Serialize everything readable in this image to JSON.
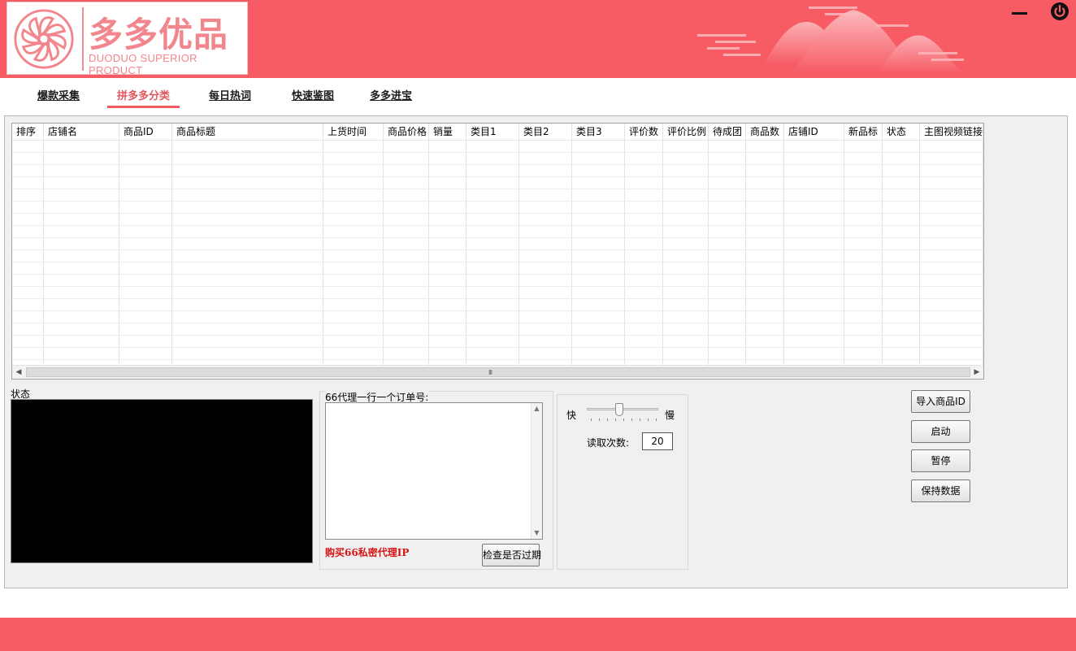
{
  "app": {
    "logo_cn": "多多优品",
    "logo_en": "DUODUO SUPERIOR PRODUCT"
  },
  "tabs": [
    {
      "label": "爆款采集",
      "active": false
    },
    {
      "label": "拼多多分类",
      "active": true
    },
    {
      "label": "每日热词",
      "active": false
    },
    {
      "label": "快速鉴图",
      "active": false
    },
    {
      "label": "多多进宝",
      "active": false
    }
  ],
  "grid": {
    "columns": [
      "排序",
      "店铺名",
      "商品ID",
      "商品标题",
      "上货时间",
      "商品价格",
      "销量",
      "类目1",
      "类目2",
      "类目3",
      "评价数",
      "评价比例",
      "待成团",
      "商品数",
      "店铺ID",
      "新品标",
      "状态",
      "主图视频链接"
    ],
    "rows": [],
    "scroll_grip": "III"
  },
  "status": {
    "label": "状态"
  },
  "proxy": {
    "label": "66代理一行一个订单号:",
    "value": "",
    "buy_link": "购买66私密代理IP",
    "check_button": "检查是否过期"
  },
  "speed": {
    "fast_label": "快",
    "slow_label": "慢",
    "read_count_label": "读取次数:",
    "read_count_value": "20",
    "slider_level": 0.45
  },
  "actions": {
    "import_button": "导入商品ID",
    "start_button": "启动",
    "pause_button": "暂停",
    "save_button": "保持数据"
  },
  "colors": {
    "brand": "#f75b64",
    "logo_text": "#f2868c",
    "active_tab": "#e0565d",
    "link_red": "#d51414"
  },
  "icons": {
    "minimize": "minimize-icon",
    "power": "power-icon",
    "logo": "pinwheel-flower-logo"
  }
}
